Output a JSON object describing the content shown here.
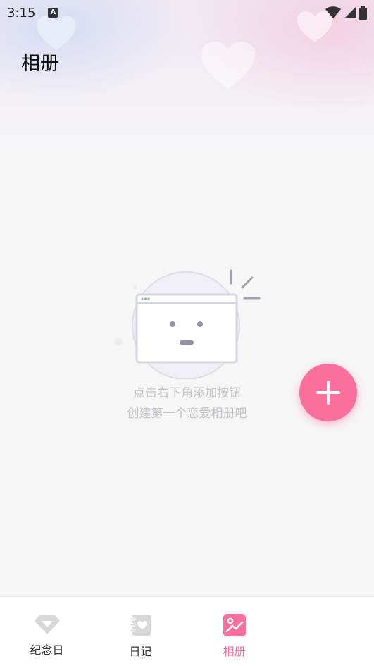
{
  "status_bar": {
    "time": "3:15",
    "icons": [
      "a-icon",
      "wifi-icon",
      "signal-icon",
      "battery-icon"
    ]
  },
  "header": {
    "title": "相册"
  },
  "empty_state": {
    "line1": "点击右下角添加按钮",
    "line2": "创建第一个恋爱相册吧"
  },
  "fab": {
    "icon": "plus-icon",
    "color": "#fb6f9c"
  },
  "bottom_nav": {
    "items": [
      {
        "label": "纪念日",
        "icon": "diamond-icon"
      },
      {
        "label": "日记",
        "icon": "diary-icon"
      },
      {
        "label": "相册",
        "icon": "album-icon",
        "active": true
      }
    ],
    "active_color": "#fb6f9c"
  }
}
